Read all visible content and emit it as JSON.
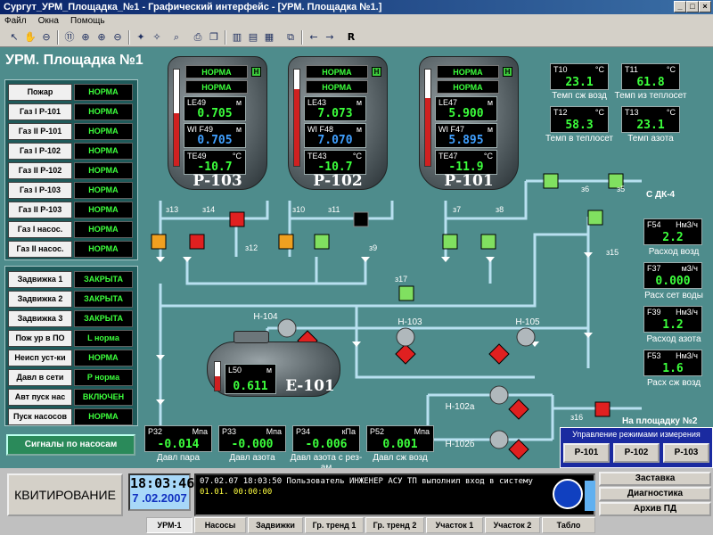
{
  "window": {
    "title": "Сургут_УРМ_Площадка_№1 - Графический интерфейс - [УРМ. Площадка №1.]"
  },
  "menu": [
    "Файл",
    "Окна",
    "Помощь"
  ],
  "screen_title": "УРМ. Площадка №1",
  "status_panel": [
    {
      "label": "Пожар",
      "value": "НОРМА"
    },
    {
      "label": "Газ I Р-101",
      "value": "НОРМА"
    },
    {
      "label": "Газ II Р-101",
      "value": "НОРМА"
    },
    {
      "label": "Газ I Р-102",
      "value": "НОРМА"
    },
    {
      "label": "Газ II Р-102",
      "value": "НОРМА"
    },
    {
      "label": "Газ I Р-103",
      "value": "НОРМА"
    },
    {
      "label": "Газ II Р-103",
      "value": "НОРМА"
    },
    {
      "label": "Газ I насос.",
      "value": "НОРМА"
    },
    {
      "label": "Газ II насос.",
      "value": "НОРМА"
    }
  ],
  "valve_panel": [
    {
      "label": "Задвижка 1",
      "value": "ЗАКРЫТА"
    },
    {
      "label": "Задвижка 2",
      "value": "ЗАКРЫТА"
    },
    {
      "label": "Задвижка 3",
      "value": "ЗАКРЫТА"
    },
    {
      "label": "Пож ур в ПО",
      "value": "L норма"
    },
    {
      "label": "Неисп уст-ки",
      "value": "НОРМА"
    },
    {
      "label": "Давл в сети",
      "value": "P норма"
    },
    {
      "label": "Авт пуск нас",
      "value": "ВКЛЮЧЕН"
    },
    {
      "label": "Пуск насосов",
      "value": "НОРМА"
    }
  ],
  "pump_signals_button": "Сигналы по насосам",
  "vessels": [
    {
      "name": "Р-103",
      "status1": "НОРМА",
      "status2": "НОРМА",
      "h": "H",
      "level_tag": "LE49",
      "level_unit": "м",
      "level": "0.705",
      "wf_tag": "WI F49",
      "wf_unit": "м",
      "wf": "0.705",
      "temp_tag": "TE49",
      "temp_unit": "°C",
      "temp": "-10.7",
      "level_pct": 0.55
    },
    {
      "name": "Р-102",
      "status1": "НОРМА",
      "status2": "НОРМА",
      "h": "H",
      "level_tag": "LE43",
      "level_unit": "м",
      "level": "7.073",
      "wf_tag": "WI F48",
      "wf_unit": "м",
      "wf": "7.070",
      "temp_tag": "TE43",
      "temp_unit": "°C",
      "temp": "-10.7",
      "level_pct": 0.8
    },
    {
      "name": "Р-101",
      "status1": "НОРМА",
      "status2": "НОРМА",
      "h": "H",
      "level_tag": "LE47",
      "level_unit": "м",
      "level": "5.900",
      "wf_tag": "WI F47",
      "wf_unit": "м",
      "wf": "5.895",
      "temp_tag": "TE47",
      "temp_unit": "°C",
      "temp": "-11.9",
      "level_pct": 0.7
    }
  ],
  "temps": [
    {
      "tag": "T10",
      "unit": "°C",
      "value": "23.1",
      "caption": "Темп сж возд"
    },
    {
      "tag": "T11",
      "unit": "°C",
      "value": "61.8",
      "caption": "Темп из теплосет"
    },
    {
      "tag": "T12",
      "unit": "°C",
      "value": "58.3",
      "caption": "Темп в теплосет"
    },
    {
      "tag": "T13",
      "unit": "°C",
      "value": "23.1",
      "caption": "Темп азота"
    }
  ],
  "flows": [
    {
      "tag": "F54",
      "unit": "Нм3/ч",
      "value": "2.2",
      "caption": "Расход возд"
    },
    {
      "tag": "F37",
      "unit": "м3/ч",
      "value": "0.000",
      "caption": "Расх сет воды"
    },
    {
      "tag": "F39",
      "unit": "Нм3/ч",
      "value": "1.2",
      "caption": "Расход азота"
    },
    {
      "tag": "F53",
      "unit": "Нм3/ч",
      "value": "1.6",
      "caption": "Расх сж возд"
    }
  ],
  "tank": {
    "name": "Е-101",
    "tag": "L50",
    "unit": "м",
    "value": "0.611",
    "level_pct": 0.5
  },
  "pressures": [
    {
      "tag": "P32",
      "unit": "Мпа",
      "value": "-0.014",
      "caption": "Давл пара"
    },
    {
      "tag": "P33",
      "unit": "Мпа",
      "value": "-0.000",
      "caption": "Давл азота"
    },
    {
      "tag": "P34",
      "unit": "кПа",
      "value": "-0.006",
      "caption": "Давл азота с рез-ам"
    },
    {
      "tag": "P52",
      "unit": "Мпа",
      "value": "0.001",
      "caption": "Давл сж возд"
    }
  ],
  "pumps": [
    "Н-104",
    "Н-103",
    "Н-105",
    "Н-102а",
    "Н-102б"
  ],
  "valves": [
    "з13",
    "з14",
    "з12",
    "з10",
    "з11",
    "з9",
    "з7",
    "з8",
    "з6",
    "з5",
    "з15",
    "з17",
    "з16"
  ],
  "sdk": "С ДК-4",
  "to_site2": "На площадку №2",
  "mode_control": {
    "title": "Управление режимами измерения",
    "buttons": [
      "Р-101",
      "Р-102",
      "Р-103"
    ]
  },
  "ack_button": "КВИТИРОВАНИЕ",
  "clock": {
    "time": "18:03:46",
    "date": "7 .02.2007"
  },
  "log": {
    "line1": "07.02.07 18:03:50  Пользователь ИНЖЕНЕР АСУ ТП выполнил вход в систему",
    "line2": "01.01.  00:00:00"
  },
  "right_buttons": [
    "Заставка",
    "Диагностика",
    "Архив ПД"
  ],
  "tabs": [
    "УРМ-1",
    "Насосы",
    "Задвижки",
    "Гр. тренд 1",
    "Гр. тренд 2",
    "Участок 1",
    "Участок 2",
    "Табло"
  ]
}
